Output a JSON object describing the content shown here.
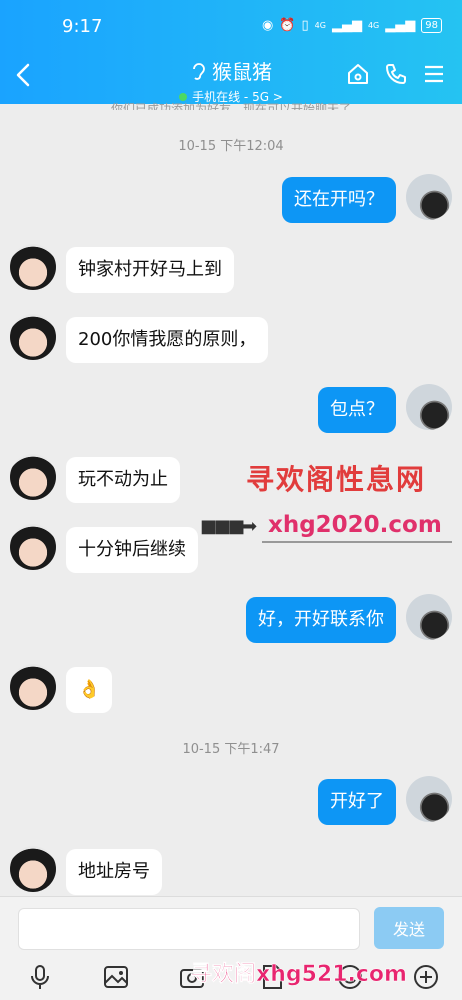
{
  "status_bar": {
    "time": "9:17",
    "battery": "98",
    "signal1": "4G",
    "signal2": "4G"
  },
  "header": {
    "title": "猴鼠猪",
    "subtitle": "手机在线 - 5G >"
  },
  "system_note": "你们已成功添加为好友，现在可以开始聊天了",
  "messages": [
    {
      "type": "timestamp",
      "text": "10-15 下午12:04"
    },
    {
      "type": "out",
      "text": "还在开吗？"
    },
    {
      "type": "in",
      "text": "钟家村开好马上到"
    },
    {
      "type": "in",
      "text": "200你情我愿的原则，"
    },
    {
      "type": "out",
      "text": "包点？"
    },
    {
      "type": "in",
      "text": "玩不动为止"
    },
    {
      "type": "in",
      "text": "十分钟后继续"
    },
    {
      "type": "out",
      "text": "好，开好联系你"
    },
    {
      "type": "in",
      "text": "👌"
    },
    {
      "type": "timestamp",
      "text": "10-15 下午1:47"
    },
    {
      "type": "out",
      "text": "开好了"
    },
    {
      "type": "in",
      "text": "地址房号"
    }
  ],
  "watermarks": {
    "line1": "寻欢阁性息网",
    "line2": "xhg2020.com",
    "bottom": "寻欢阁xhg521.com"
  },
  "input": {
    "value": "",
    "send_label": "发送"
  },
  "toolbar_icons": [
    "microphone-icon",
    "image-icon",
    "camera-icon",
    "file-icon",
    "emoji-icon",
    "plus-icon"
  ]
}
